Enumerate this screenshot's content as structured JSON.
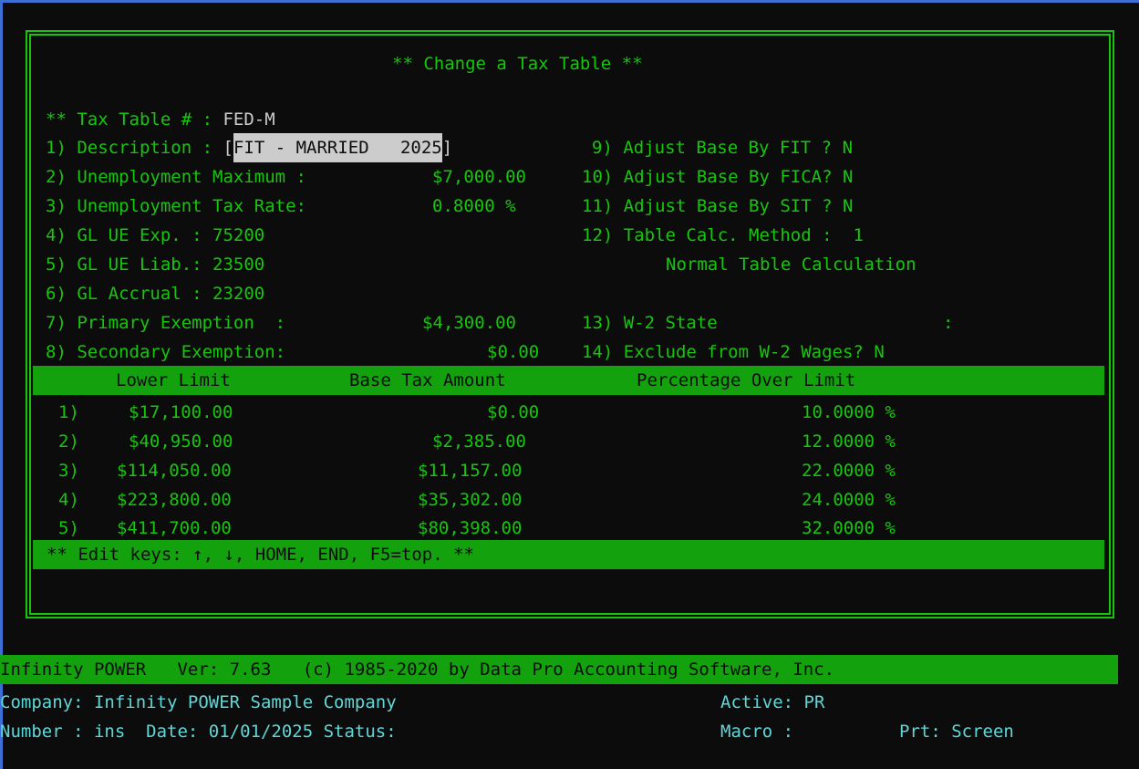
{
  "screen": {
    "title": "** Change a Tax Table **",
    "tax_table_label": "** Tax Table # :",
    "tax_table_value": "FED-M"
  },
  "fields_left": [
    {
      "label": "1) Description :",
      "value_open": "[",
      "value": "FIT - MARRIED   2025",
      "value_close": "]"
    },
    {
      "label": "2) Unemployment Maximum :",
      "value": "$7,000.00"
    },
    {
      "label": "3) Unemployment Tax Rate:",
      "value": "0.8000 %"
    },
    {
      "label": "4) GL UE Exp. :",
      "value": "75200"
    },
    {
      "label": "5) GL UE Liab.:",
      "value": "23500"
    },
    {
      "label": "6) GL Accrual :",
      "value": "23200"
    },
    {
      "label": "7) Primary Exemption  :",
      "value": "$4,300.00"
    },
    {
      "label": "8) Secondary Exemption:",
      "value": "$0.00"
    }
  ],
  "fields_right": [
    {
      "label": "9) Adjust Base By FIT ?",
      "value": "N"
    },
    {
      "label": "10) Adjust Base By FICA?",
      "value": "N"
    },
    {
      "label": "11) Adjust Base By SIT ?",
      "value": "N"
    },
    {
      "label": "12) Table Calc. Method :",
      "value": "1"
    },
    {
      "label": "",
      "value": "Normal Table Calculation"
    },
    {
      "label": "13) W-2 State",
      "value": ":"
    },
    {
      "label": "14) Exclude from W-2 Wages?",
      "value": "N"
    }
  ],
  "table": {
    "headers": [
      "Lower Limit",
      "Base Tax Amount",
      "Percentage Over Limit"
    ],
    "rows": [
      {
        "num": "1)",
        "lower": "$17,100.00",
        "base": "$0.00",
        "pct": "10.0000 %"
      },
      {
        "num": "2)",
        "lower": "$40,950.00",
        "base": "$2,385.00",
        "pct": "12.0000 %"
      },
      {
        "num": "3)",
        "lower": "$114,050.00",
        "base": "$11,157.00",
        "pct": "22.0000 %"
      },
      {
        "num": "4)",
        "lower": "$223,800.00",
        "base": "$35,302.00",
        "pct": "24.0000 %"
      },
      {
        "num": "5)",
        "lower": "$411,700.00",
        "base": "$80,398.00",
        "pct": "32.0000 %"
      }
    ]
  },
  "edit_keys": "** Edit keys: ↑, ↓, HOME, END, F5=top. **",
  "footer": {
    "banner": "Infinity POWER   Ver: 7.63   (c) 1985-2020 by Data Pro Accounting Software, Inc.",
    "company": "Company: Infinity POWER Sample Company",
    "active": "Active: PR",
    "number": "Number : ins  Date: 01/01/2025 Status:",
    "macro": "Macro :",
    "prt": "Prt: Screen"
  },
  "colors": {
    "background": "#0c0c0c",
    "text_green": "#16c60c",
    "bar_green": "#13a10e",
    "status_cyan": "#61d6d6",
    "highlight": "#cccccc"
  }
}
